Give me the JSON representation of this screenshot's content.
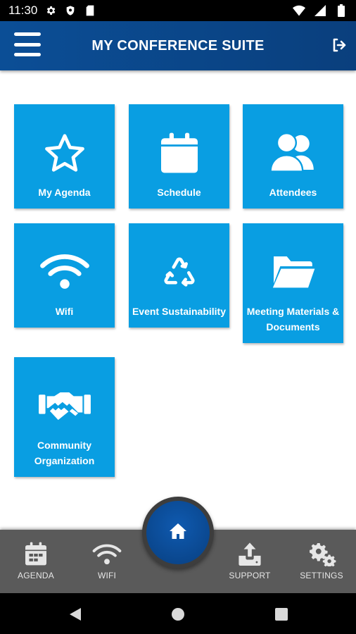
{
  "status_bar": {
    "time": "11:30",
    "icons_left": [
      "gear-icon",
      "shield-icon",
      "sd-card-icon"
    ],
    "icons_right": [
      "wifi-icon",
      "signal-icon",
      "battery-icon"
    ]
  },
  "header": {
    "title": "MY CONFERENCE SUITE",
    "menu_icon": "hamburger-menu-icon",
    "logout_icon": "logout-icon",
    "color": "#0b4e96"
  },
  "tiles": [
    {
      "label": "My Agenda",
      "icon": "star-icon"
    },
    {
      "label": "Schedule",
      "icon": "calendar-icon"
    },
    {
      "label": "Attendees",
      "icon": "users-icon"
    },
    {
      "label": "Wifi",
      "icon": "wifi-icon"
    },
    {
      "label": "Event Sustainability",
      "icon": "recycle-icon"
    },
    {
      "label": "Meeting Materials & Documents",
      "icon": "folder-open-icon"
    },
    {
      "label": "Community Organization",
      "icon": "handshake-icon"
    }
  ],
  "tile_color": "#099ee2",
  "bottom_nav": {
    "items": [
      {
        "label": "AGENDA",
        "icon": "calendar-icon"
      },
      {
        "label": "WIFI",
        "icon": "wifi-icon"
      },
      {
        "label": "SUPPORT",
        "icon": "upload-icon"
      },
      {
        "label": "SETTINGS",
        "icon": "gears-icon"
      }
    ],
    "home_icon": "home-icon",
    "background": "#5a5a5a"
  },
  "system_nav": {
    "buttons": [
      "back-icon",
      "home-circle-icon",
      "recents-icon"
    ]
  }
}
